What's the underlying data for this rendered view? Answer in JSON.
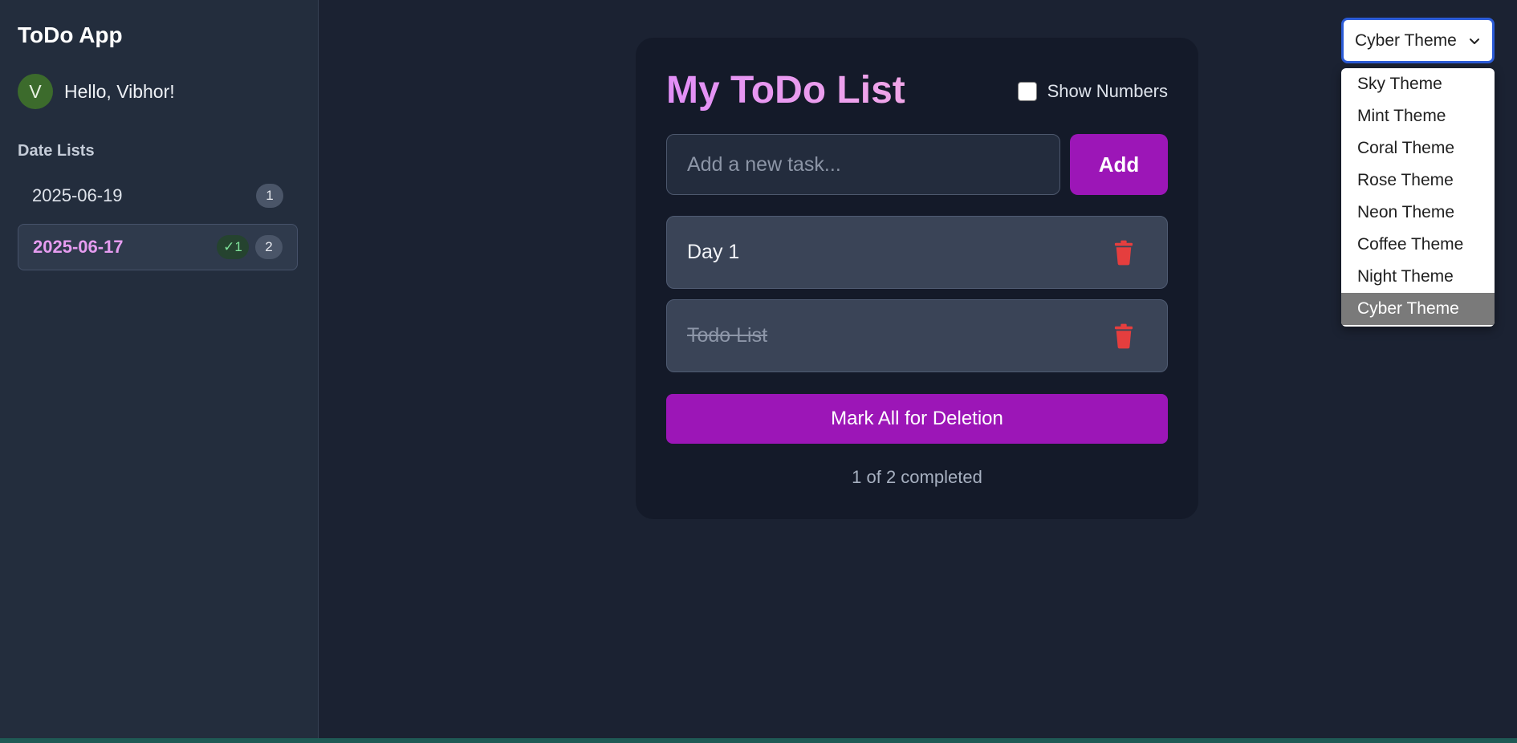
{
  "sidebar": {
    "app_title": "ToDo App",
    "user": {
      "avatar_initial": "V",
      "greeting": "Hello, Vibhor!"
    },
    "section_label": "Date Lists",
    "dates": [
      {
        "label": "2025-06-19",
        "count": "1"
      },
      {
        "label": "2025-06-17",
        "done_badge": "✓1",
        "count": "2",
        "active": true
      }
    ]
  },
  "theme": {
    "selected": "Cyber Theme",
    "options": [
      "Sky Theme",
      "Mint Theme",
      "Coral Theme",
      "Rose Theme",
      "Neon Theme",
      "Coffee Theme",
      "Night Theme",
      "Cyber Theme"
    ]
  },
  "main": {
    "title": "My ToDo List",
    "show_numbers_label": "Show Numbers",
    "show_numbers_checked": false,
    "input_placeholder": "Add a new task...",
    "add_label": "Add",
    "tasks": [
      {
        "text": "Day 1",
        "completed": false
      },
      {
        "text": "Todo List",
        "completed": true
      }
    ],
    "mark_all_label": "Mark All for Deletion",
    "progress": "1 of 2 completed"
  },
  "colors": {
    "accent": "#9c16b7",
    "title_gradient": "#e28ef7",
    "delete_icon": "#e53e3e",
    "background": "#1b2232",
    "card": "#141a29"
  },
  "icons": {
    "trash": "trash-icon",
    "chevron": "chevron-down-icon"
  }
}
